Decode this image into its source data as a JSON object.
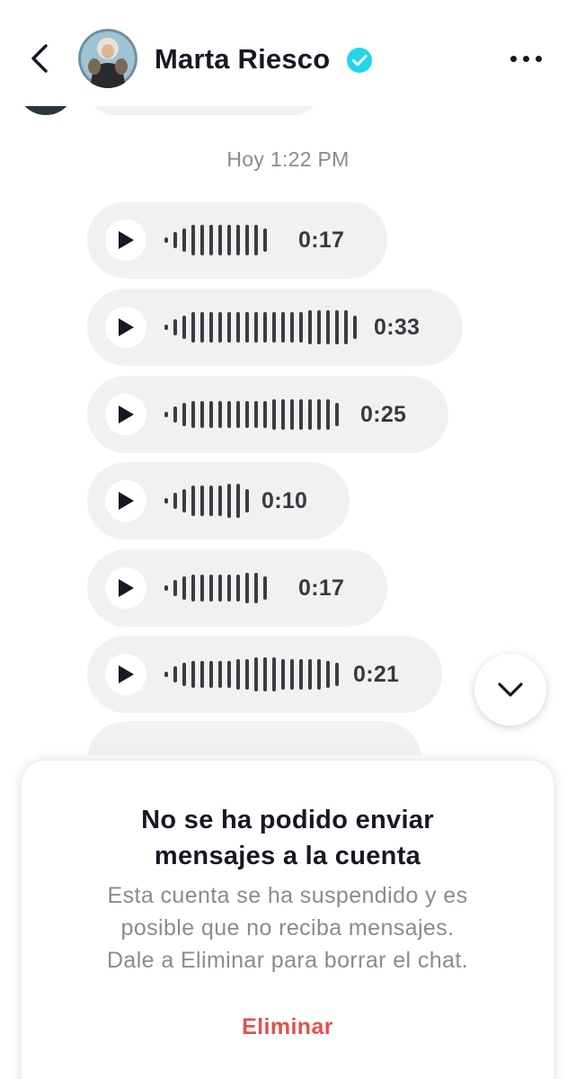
{
  "header": {
    "contact_name": "Marta Riesco",
    "verified": true
  },
  "chat": {
    "timestamp": "Hoy 1:22 PM",
    "voice_messages": [
      {
        "duration": "0:17"
      },
      {
        "duration": "0:33"
      },
      {
        "duration": "0:25"
      },
      {
        "duration": "0:10"
      },
      {
        "duration": "0:17"
      },
      {
        "duration": "0:21"
      }
    ]
  },
  "alert": {
    "title_line1": "No se ha podido enviar",
    "title_line2": "mensajes a la cuenta",
    "body_line1": "Esta cuenta se ha suspendido y es",
    "body_line2": "posible que no reciba mensajes.",
    "body_line3": "Dale a Eliminar para borrar el chat.",
    "delete_label": "Eliminar"
  },
  "colors": {
    "verified_badge": "#20d5ec",
    "delete_action": "#e0524a",
    "bubble_background": "#f1f1f2",
    "text_primary": "#161823",
    "text_secondary": "#8a8b91"
  },
  "icons": {
    "back": "chevron-left-icon",
    "verified": "verified-badge-icon",
    "more": "more-horizontal-icon",
    "play": "play-icon",
    "scroll_down": "chevron-down-icon"
  }
}
